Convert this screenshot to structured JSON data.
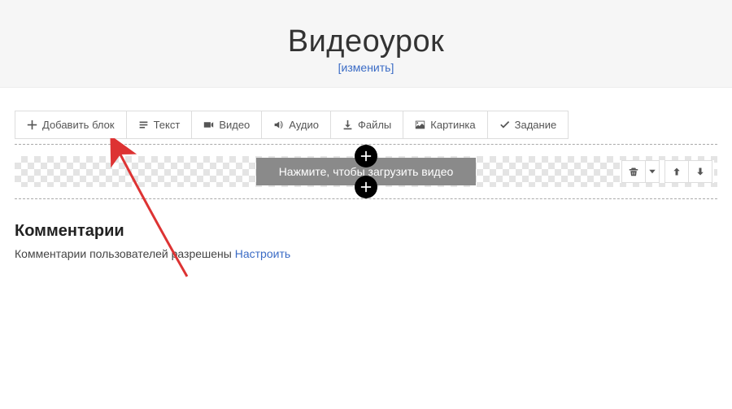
{
  "header": {
    "title": "Видеоурок",
    "edit_link": "[изменить]"
  },
  "toolbar": {
    "add_block": "Добавить блок",
    "text": "Текст",
    "video": "Видео",
    "audio": "Аудио",
    "files": "Файлы",
    "image": "Картинка",
    "task": "Задание"
  },
  "video_block": {
    "upload_label": "Нажмите, чтобы загрузить видео"
  },
  "comments": {
    "heading": "Комментарии",
    "status_text": "Комментарии пользователей разрешены ",
    "configure": "Настроить"
  }
}
